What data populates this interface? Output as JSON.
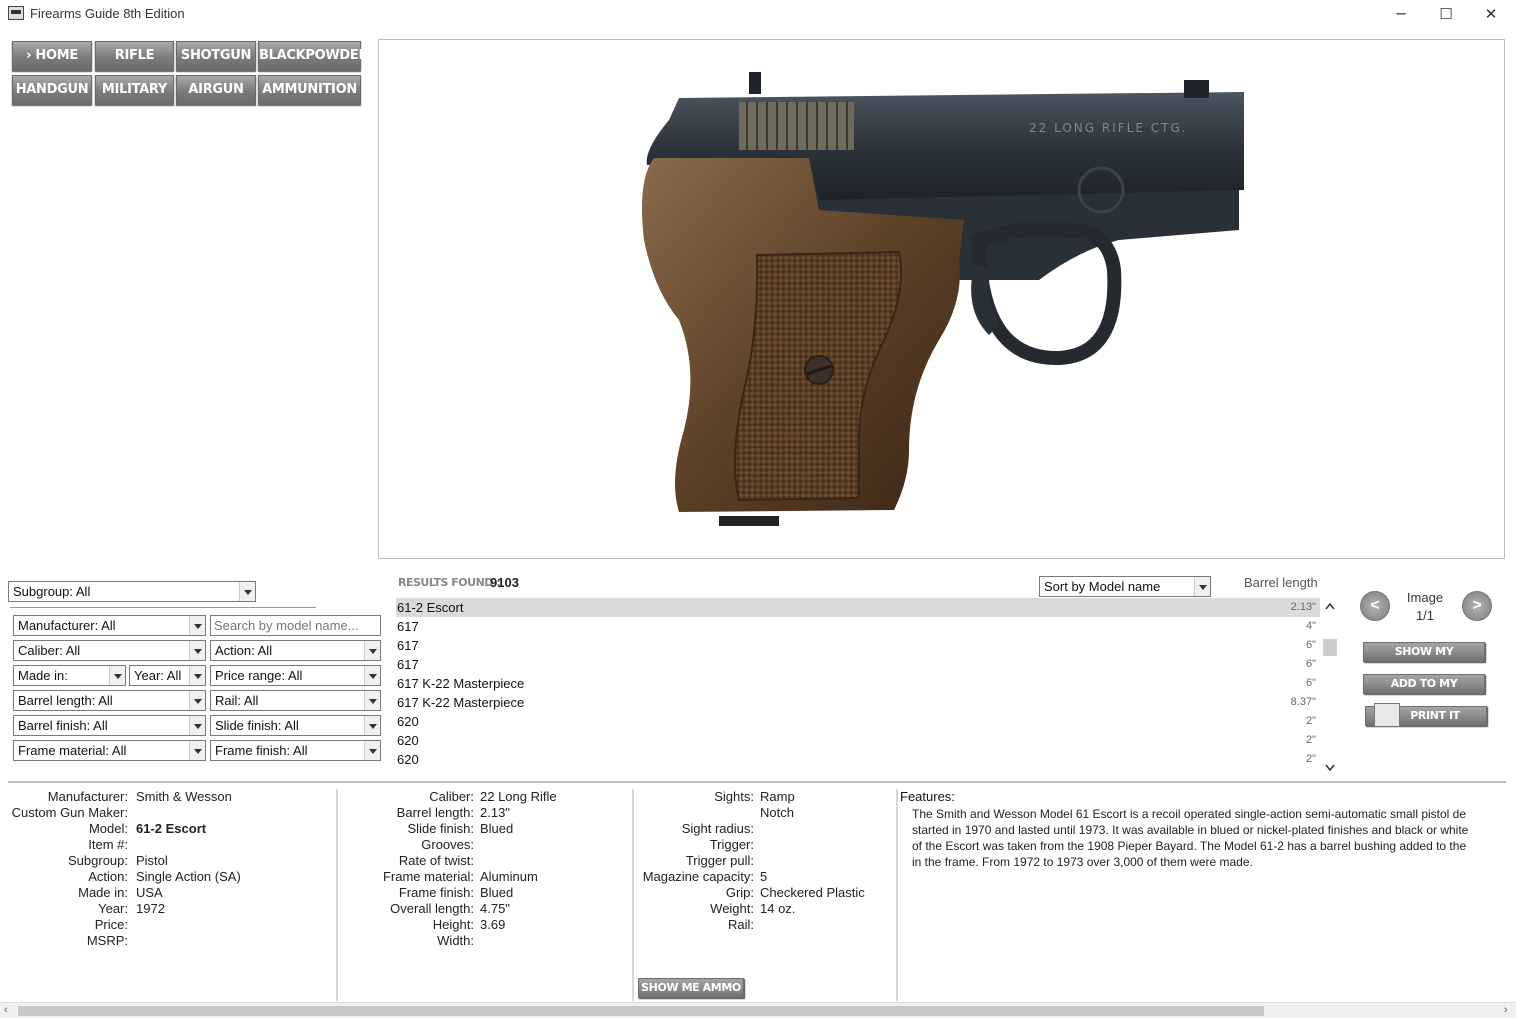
{
  "window": {
    "title": "Firearms Guide 8th Edition",
    "minimize": "─",
    "maximize": "☐",
    "close": "✕"
  },
  "nav": {
    "home": "› HOME",
    "rifle": "RIFLE",
    "shotgun": "SHOTGUN",
    "blackpowder": "BLACKPOWDER",
    "handgun": "HANDGUN",
    "military": "MILITARY",
    "airgun": "AIRGUN",
    "ammunition": "AMMUNITION"
  },
  "image": {
    "engraving": "22 LONG RIFLE CTG."
  },
  "filters": {
    "subgroup": "Subgroup: All",
    "manufacturer": "Manufacturer: All",
    "search_placeholder": "Search by model name...",
    "caliber": "Caliber: All",
    "action": "Action: All",
    "made_in": "Made in:",
    "year": "Year: All",
    "price_range": "Price range: All",
    "barrel_length": "Barrel length: All",
    "rail": "Rail: All",
    "barrel_finish": "Barrel finish: All",
    "slide_finish": "Slide finish: All",
    "frame_material": "Frame material: All",
    "frame_finish": "Frame finish: All"
  },
  "results": {
    "label": "RESULTS FOUND :",
    "count": "9103",
    "sort": "Sort by Model name",
    "barrel_header": "Barrel length",
    "rows": [
      {
        "name": "61-2 Escort",
        "barrel": "2.13\""
      },
      {
        "name": "617",
        "barrel": "4\""
      },
      {
        "name": "617",
        "barrel": "6\""
      },
      {
        "name": "617",
        "barrel": "6\""
      },
      {
        "name": "617 K-22 Masterpiece",
        "barrel": "6\""
      },
      {
        "name": "617 K-22 Masterpiece",
        "barrel": "8.37\""
      },
      {
        "name": "620",
        "barrel": "2\""
      },
      {
        "name": "620",
        "barrel": "2\""
      },
      {
        "name": "620",
        "barrel": "2\""
      }
    ]
  },
  "image_nav": {
    "prev": "<",
    "next": ">",
    "label": "Image",
    "counter": "1/1"
  },
  "side_buttons": {
    "show_favorites": "SHOW MY FAVORITES",
    "add_favorites": "ADD TO MY FAVORITES",
    "print": "PRINT IT"
  },
  "details": {
    "col1": [
      {
        "label": "Manufacturer:",
        "value": "Smith & Wesson"
      },
      {
        "label": "Custom Gun Maker:",
        "value": ""
      },
      {
        "label": "Model:",
        "value": "61-2 Escort"
      },
      {
        "label": "Item #:",
        "value": ""
      },
      {
        "label": "Subgroup:",
        "value": "Pistol"
      },
      {
        "label": "Action:",
        "value": "Single Action (SA)"
      },
      {
        "label": "Made in:",
        "value": "USA"
      },
      {
        "label": "Year:",
        "value": "1972"
      },
      {
        "label": "Price:",
        "value": ""
      },
      {
        "label": "MSRP:",
        "value": ""
      }
    ],
    "col2": [
      {
        "label": "Caliber:",
        "value": "22 Long Rifle"
      },
      {
        "label": "Barrel length:",
        "value": "2.13\""
      },
      {
        "label": "Slide finish:",
        "value": "Blued"
      },
      {
        "label": "Grooves:",
        "value": ""
      },
      {
        "label": "Rate of twist:",
        "value": ""
      },
      {
        "label": "Frame material:",
        "value": "Aluminum"
      },
      {
        "label": "Frame finish:",
        "value": "Blued"
      },
      {
        "label": "Overall length:",
        "value": "4.75\""
      },
      {
        "label": "Height:",
        "value": "3.69"
      },
      {
        "label": "Width:",
        "value": ""
      }
    ],
    "col3": [
      {
        "label": "Sights:",
        "value": "Ramp"
      },
      {
        "label": "",
        "value": "Notch"
      },
      {
        "label": "Sight radius:",
        "value": ""
      },
      {
        "label": "Trigger:",
        "value": ""
      },
      {
        "label": "Trigger pull:",
        "value": ""
      },
      {
        "label": "Magazine capacity:",
        "value": "5"
      },
      {
        "label": "Grip:",
        "value": "Checkered Plastic"
      },
      {
        "label": "Weight:",
        "value": "14 oz."
      },
      {
        "label": "Rail:",
        "value": ""
      }
    ],
    "features_label": "Features:",
    "features_text": "The Smith and Wesson Model 61 Escort is a recoil operated single-action semi-automatic small pistol de\nstarted in 1970 and lasted until 1973. It was available in blued or nickel-plated finishes and black or white\nof the Escort was taken from the 1908 Pieper Bayard. The Model 61-2 has a barrel bushing added to the\nin the frame. From 1972 to 1973 over 3,000 of them were made.",
    "show_ammo": "SHOW ME AMMO"
  }
}
